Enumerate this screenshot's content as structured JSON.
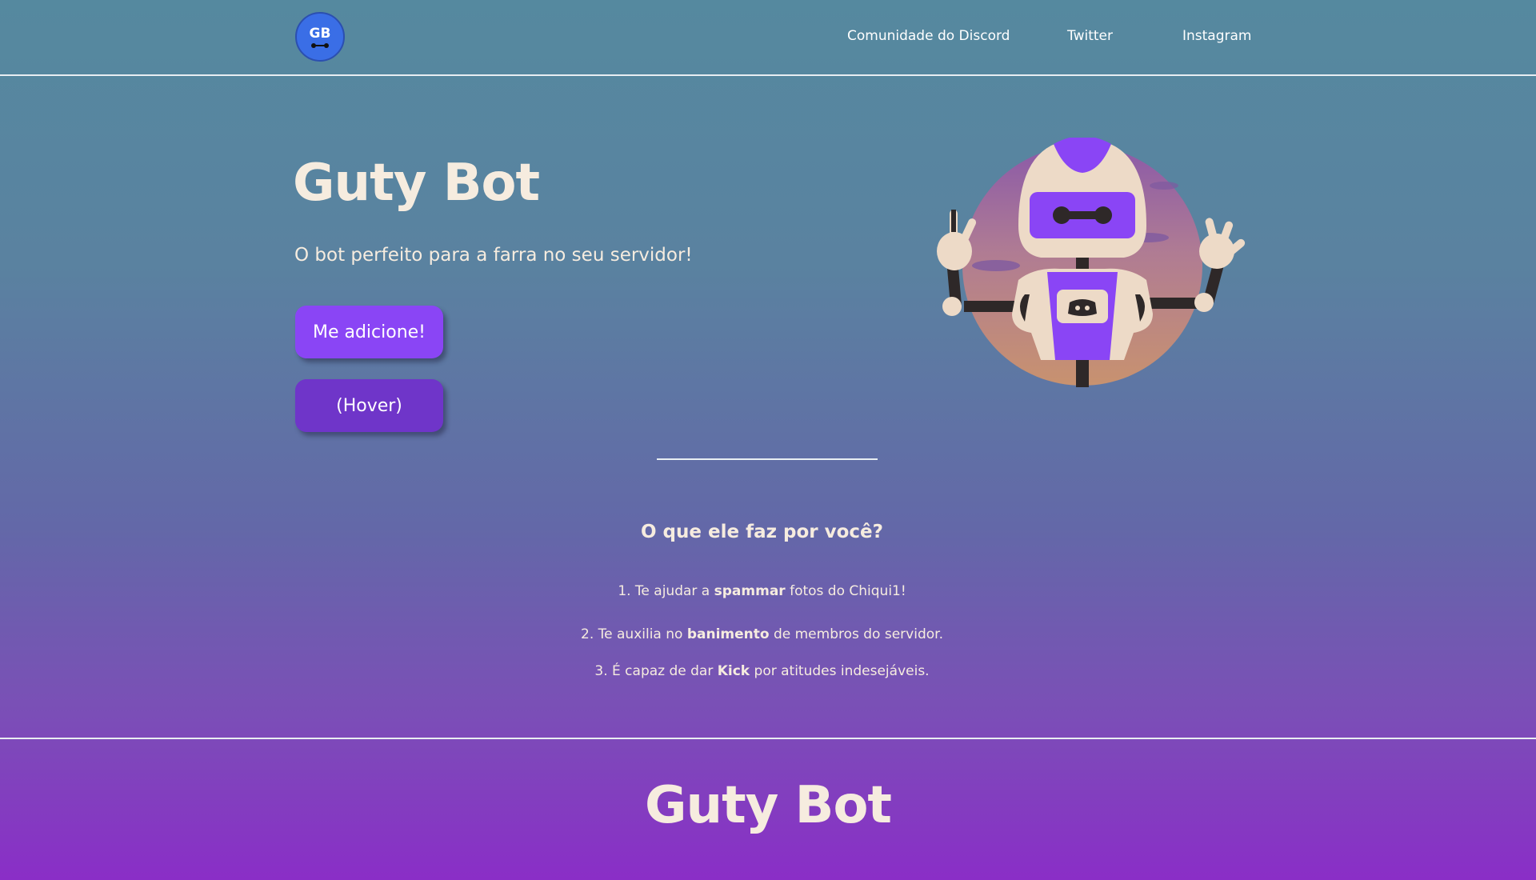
{
  "header": {
    "logo_text": "GB",
    "nav": [
      "Comunidade do Discord",
      "Twitter",
      "Instagram"
    ]
  },
  "hero": {
    "title": "Guty Bot",
    "subtitle": "O bot perfeito para a farra no seu servidor!",
    "primary_button": "Me adicione!",
    "hover_button": "(Hover)"
  },
  "features": {
    "title": "O que ele faz por você?",
    "items": [
      {
        "before": "1. Te ajudar a ",
        "bold": "spammar",
        "after": " fotos do Chiqui1!"
      },
      {
        "before": "2. Te auxilia no ",
        "bold": "banimento",
        "after": " de membros do servidor."
      },
      {
        "before": "3. É capaz de dar ",
        "bold": "Kick",
        "after": " por atitudes indesejáveis."
      }
    ]
  },
  "footer": {
    "title": "Guty Bot"
  },
  "colors": {
    "accent": "#8a45f5",
    "accent_hover": "#6f35c9",
    "logo_blue": "#3a6ee6",
    "text_cream": "#f6ecdf"
  },
  "icons": {
    "logo": "gb-logo-icon",
    "robot": "robot-illustration"
  }
}
